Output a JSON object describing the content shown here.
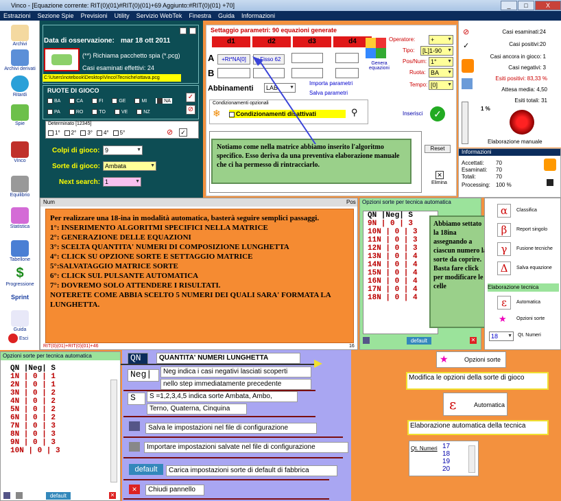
{
  "window": {
    "title": "Vinco - [Equazione corrente: RIT(0)(01)#RIT(0)(01)+69 Aggiunto:#RIT(0)(01) +70]",
    "min": "_",
    "max": "□",
    "close": "X"
  },
  "menu": [
    "Estrazioni",
    "Sezione Spie",
    "Previsioni",
    "Utility",
    "Servizio WebTek",
    "Finestra",
    "Guida",
    "Informazioni"
  ],
  "sidebar": [
    "Archivi",
    "Archivi derivati",
    "Ritardi",
    "Spie",
    "Vinco",
    "Equilibrio",
    "Statistica",
    "Tabellone",
    "Progressione",
    "Sprint",
    "Guida",
    "Esci"
  ],
  "observation": {
    "label": "Data di osservazione:",
    "date": "mar 18 ott 2011",
    "spy": "(**) Richiama pacchetto spia (*.pcg)",
    "cases": "Casi esaminati effettivi: 24",
    "path": "C:\\Users\\notebook\\Desktop\\Vinco\\Tecniche\\ottava.pcg"
  },
  "wheels": {
    "title": "RUOTE DI GIOCO",
    "items": [
      "BA",
      "CA",
      "FI",
      "GE",
      "MI",
      "NA",
      "PA",
      "RO",
      "TO",
      "VE",
      "NZ"
    ]
  },
  "determinato": {
    "title": "Determinato [12345]",
    "items": [
      "1°",
      "2°",
      "3°",
      "4°",
      "5°"
    ]
  },
  "play": {
    "colpi_label": "Colpi di gioco:",
    "colpi": "9",
    "sorte_label": "Sorte di gioco:",
    "sorte": "Ambata",
    "next_label": "Next search:",
    "next": "1"
  },
  "params": {
    "title": "Settaggio parametri: 90 equazioni generate",
    "cols": [
      "d1",
      "d2",
      "d3",
      "d4"
    ],
    "rowA": "A",
    "rowB": "B",
    "btn1": "+Rt*NA[0]",
    "btn2": "+Fisso 62",
    "genera": "Genera equazioni",
    "abbinamenti": "Abbinamenti",
    "abb_value": "LAB",
    "import": "Importa parametri",
    "save": "Salva parametri",
    "cond_title": "Condizionamenti opzionali",
    "cond": "Condizionamenti disattivati",
    "inserisci": "Inserisci",
    "reset": "Reset",
    "elimina": "Elimina",
    "operatore_l": "Operatore:",
    "operatore": "+",
    "tipo_l": "Tipo:",
    "tipo": "[L]1-90",
    "pos_l": "Pos/Num:",
    "pos": "1°",
    "ruota_l": "Ruota:",
    "ruota": "BA",
    "tempo_l": "Tempo:",
    "tempo": "[0]"
  },
  "stats": {
    "esaminati": "Casi esaminati:24",
    "positivi": "Casi positivi:20",
    "ancora": "Casi ancora in gioco: 1",
    "negativi": "Casi negativi: 3",
    "esiti": "Esiti positivi: 83,33 %",
    "attesa": "Attesa media: 4,50",
    "totali": "Esiti totali: 31",
    "percent": "1 %",
    "manual": "Elaborazione manuale"
  },
  "info": {
    "title": "Informazioni",
    "accettati": "Accettati:",
    "acc_v": "70",
    "esaminati": "Esaminati:",
    "esa_v": "70",
    "totali": "Totali:",
    "tot_v": "70",
    "processing": "Processing:",
    "proc_v": "100 %"
  },
  "note1": "Notiamo come nella matrice abbiamo inserito l'algoritmo specifico. Esso deriva da una preventiva elaborazione manuale che ci ha permesso di rintracciarlo.",
  "grid": {
    "num": "Num",
    "pos": "Pos",
    "footer": "RIT(0)(01)+RIT(0)(01)+46",
    "count": "16"
  },
  "steps": {
    "intro": "Per realizzare una 18-ina  in modalità automatica, basterà seguire semplici passaggi.",
    "list": [
      "1°:  INSERIMENTO ALGORITMI SPECIFICI NELLA MATRICE",
      "2°: GENERAZIONE DELLE EQUAZIONI",
      "3°: SCELTA QUANTITA' NUMERI DI COMPOSIZIONE LUNGHETTA",
      "4°: CLICK SU OPZIONE SORTE E SETTAGGIO MATRICE",
      "5°:SALVATAGGIO MATRICE SORTE",
      "6°: CLICK SUL PULSANTE  AUTOMATICA",
      "7°: DOVREMO SOLO ATTENDERE I RISULTATI."
    ],
    "outro": "NOTERETE COME ABBIA SCELTO 5 NUMERI DEI QUALI SARA' FORMATA LA LUNGHETTA."
  },
  "opt1": {
    "title": "Opzioni sorte per tecnica automatica",
    "head": "QN  |Neg|  S",
    "rows": [
      "9N  | 0 | 3",
      "10N | 0 | 3",
      "11N | 0 | 3",
      "12N | 0 | 3",
      "13N | 0 | 4",
      "14N | 0 | 4",
      "15N | 0 | 4",
      "16N | 0 | 4",
      "17N | 0 | 4",
      "18N | 0 | 4"
    ],
    "default": "default"
  },
  "note2": "Abbiamo settato la 18ina assegnando a ciascun numero la sorte da coprire. Basta fare click per modificare le celle",
  "tools": {
    "classifica": "Classifica",
    "report": "Report singolo",
    "fusione": "Fusione tecniche",
    "salva": "Salva equazione",
    "elab": "Elaborazione tecnica",
    "automatica": "Automatica",
    "opzioni": "Opzioni sorte",
    "qt": "Qt. Numeri",
    "qt_v": "18",
    "alpha": "α",
    "beta": "β",
    "gamma": "γ",
    "delta": "Δ",
    "eps": "ε"
  },
  "opt2": {
    "title": "Opzioni sorte per tecnica automatica",
    "head": "QN  |Neg| S",
    "rows": [
      "1N  | 0 | 1",
      "2N  | 0 | 1",
      "3N  | 0 | 2",
      "4N  | 0 | 2",
      "5N  | 0 | 2",
      "6N  | 0 | 2",
      "7N  | 0 | 3",
      "8N  | 0 | 3",
      "9N  | 0 | 3",
      "10N | 0 | 3"
    ],
    "default": "default"
  },
  "legend": {
    "qn": "QN",
    "qn_t": "QUANTITA' NUMERI LUNGHETTA",
    "neg": "Neg|",
    "neg_t1": "Neg indica i casi negativi lasciati scoperti",
    "neg_t2": "nello step immediatamente precedente",
    "s": "S",
    "s_t1": "S =1,2,3,4,5 indica sorte Ambata, Ambo,",
    "s_t2": "Terno, Quaterna, Cinquina",
    "save_t": "Salva le impostazioni nel file di configurazione",
    "imp_t": "Importare impostazioni salvate nel file di configurazione",
    "def": "default",
    "def_t": "Carica impostazioni sorte di default di fabbrica",
    "close_t": "Chiudi pannello"
  },
  "legend2": {
    "opz": "Opzioni sorte",
    "opz_t": "Modifica le opzioni della sorte di gioco",
    "eps": "ε",
    "auto": "Automatica",
    "auto_t": "Elaborazione automatica della tecnica",
    "qt": "Qt. Numeri",
    "qt_list": [
      "17",
      "18",
      "19",
      "20"
    ]
  }
}
